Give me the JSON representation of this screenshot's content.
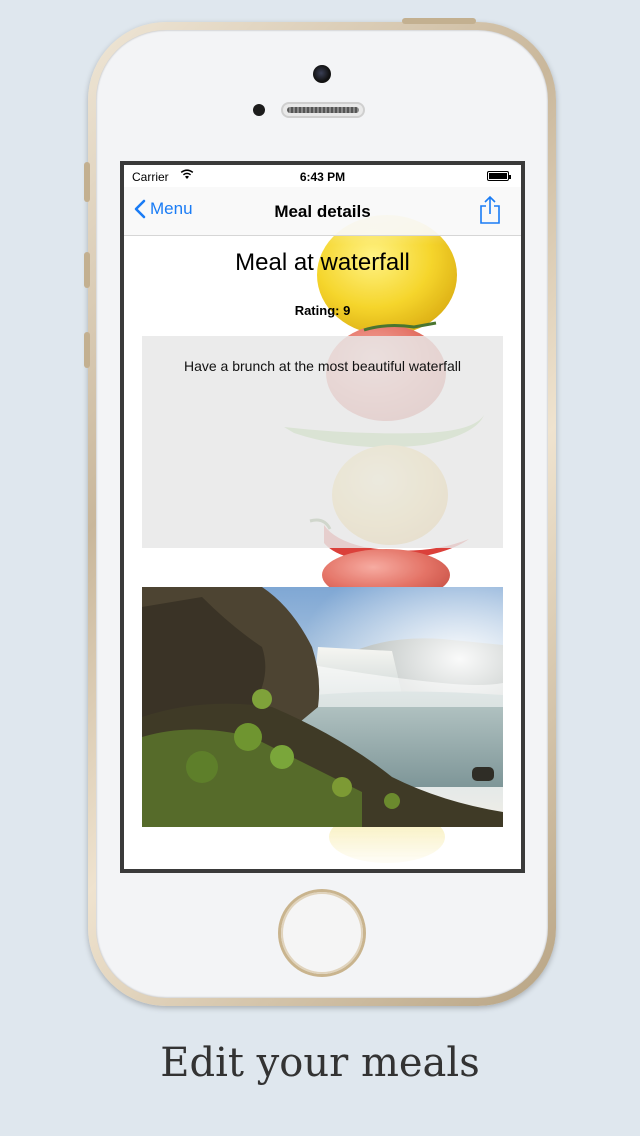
{
  "status_bar": {
    "carrier": "Carrier",
    "time": "6:43 PM"
  },
  "nav_bar": {
    "back_label": "Menu",
    "title": "Meal details",
    "share_icon": "share-icon"
  },
  "meal": {
    "title": "Meal at waterfall",
    "rating": "Rating: 9",
    "description": "Have a brunch at the most beautiful waterfall"
  },
  "caption": "Edit your meals",
  "colors": {
    "accent": "#1a7cf5",
    "background": "#dfe7ee"
  }
}
